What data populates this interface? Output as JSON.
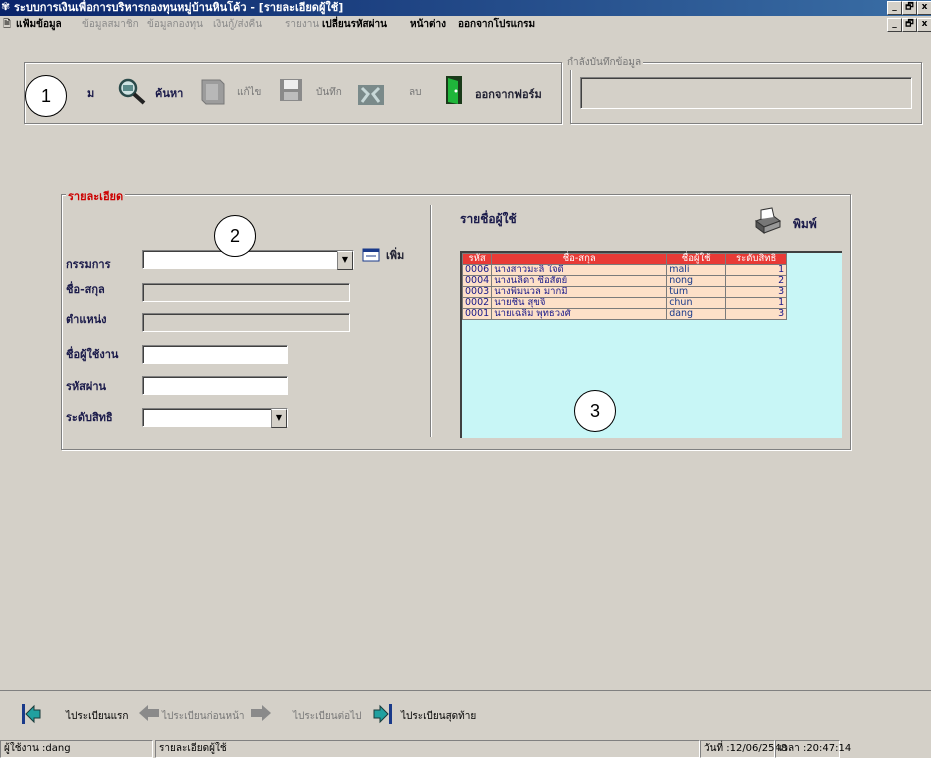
{
  "window": {
    "title": "ระบบการเงินเพื่อการบริหารกองทุนหมู่บ้านหินโค้ว - [รายละเอียดผู้ใช้]",
    "controls": [
      "_",
      "🗗",
      "x"
    ]
  },
  "menu": [
    {
      "label": "แฟ้มข้อมูล",
      "enabled": true
    },
    {
      "label": "ข้อมูลสมาชิก",
      "enabled": false
    },
    {
      "label": "ข้อมูลกองทุน",
      "enabled": false
    },
    {
      "label": "เงินกู้/ส่งคืน",
      "enabled": false
    },
    {
      "label": "รายงาน",
      "enabled": false
    },
    {
      "label": "เปลี่ยนรหัสผ่าน",
      "enabled": true
    },
    {
      "label": "หน้าต่าง",
      "enabled": true
    },
    {
      "label": "ออกจากโปรแกรม",
      "enabled": true
    }
  ],
  "toolbar": {
    "add_label": "ม",
    "search_label": "ค้นหา",
    "edit_label": "แก้ไข",
    "save_label": "บันทึก",
    "delete_label": "ลบ",
    "exit_label": "ออกจากฟอร์ม",
    "status_group_label": "กำลังบันทึกข้อมูล",
    "status_value": ""
  },
  "details": {
    "group_label": "รายละเอียด",
    "committee_label": "กรรมการ",
    "committee_value": "",
    "add_button_label": "เพิ่ม",
    "name_label": "ชื่อ-สกุล",
    "name_value": "",
    "position_label": "ตำแหน่ง",
    "position_value": "",
    "username_label": "ชื่อผู้ใช้งาน",
    "username_value": "",
    "password_label": "รหัสผ่าน",
    "password_value": "",
    "level_label": "ระดับสิทธิ",
    "level_value": ""
  },
  "users": {
    "title": "รายชื่อผู้ใช้",
    "print_label": "พิมพ์",
    "columns": [
      "รหัส",
      "ชื่อ-สกุล",
      "ชื่อผู้ใช้",
      "ระดับสิทธิ"
    ],
    "rows": [
      [
        "0006",
        "นางสาวมะลิ ใจดี",
        "mali",
        "1"
      ],
      [
        "0004",
        "นางนลิดา ซื่อสัตย์",
        "nong",
        "2"
      ],
      [
        "0003",
        "นางพิมนวล มากมี",
        "tum",
        "3"
      ],
      [
        "0002",
        "นายชื่น สุขจิ",
        "chun",
        "1"
      ],
      [
        "0001",
        "นายเฉลิม พุทธวงศ์",
        "dang",
        "3"
      ]
    ]
  },
  "navigation": {
    "first_label": "ไประเบียนแรก",
    "prev_label": "ไประเบียนก่อนหน้า",
    "next_label": "ไประเบียนต่อไป",
    "last_label": "ไประเบียนสุดท้าย"
  },
  "status": {
    "user": "ผู้ใช้งาน :dang",
    "form": "รายละเอียดผู้ใช้",
    "date": "วันที่ :12/06/2548",
    "time": "เวลา :20:47:14"
  },
  "annotations": [
    "1",
    "2",
    "3"
  ],
  "colors": {
    "titlebar": "#0a246a",
    "grid_header": "#e83a36",
    "grid_row": "#fde0c8",
    "grid_bg": "#c8f6f6",
    "section_label": "#cc0000"
  }
}
